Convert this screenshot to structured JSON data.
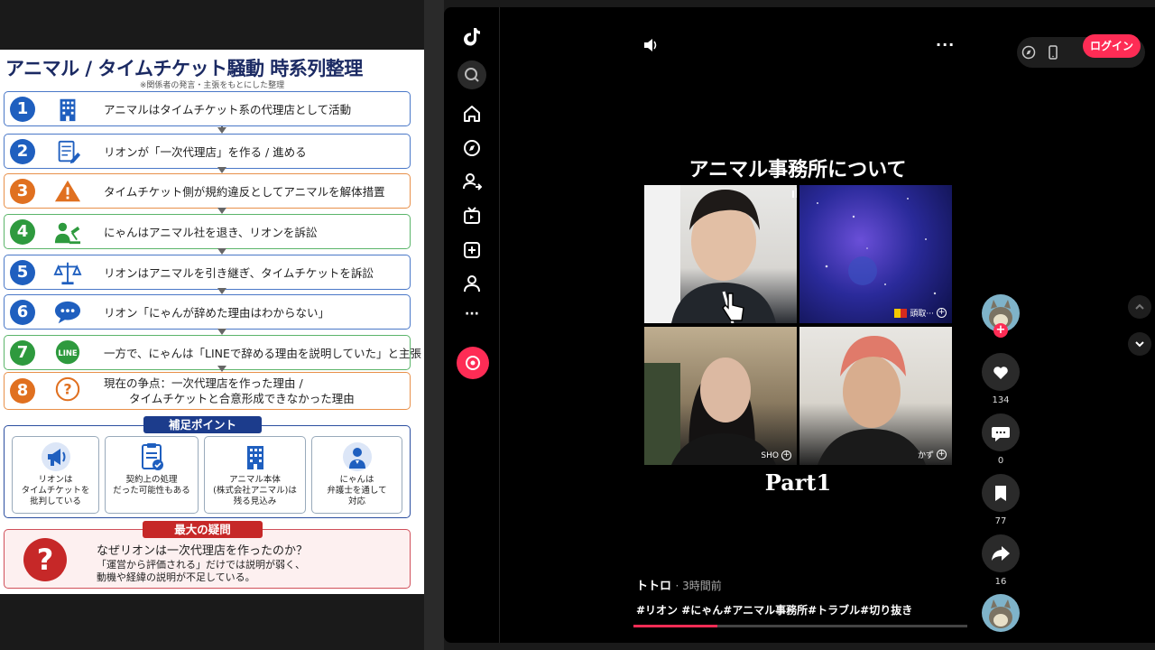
{
  "infographic": {
    "title": "アニマル / タイムチケット騒動  時系列整理",
    "subtitle": "※関係者の発言・主張をもとにした整理",
    "steps": [
      {
        "num": "1",
        "color": "#1f5fbf",
        "icon": "building-icon",
        "text": "アニマルはタイムチケット系の代理店として活動"
      },
      {
        "num": "2",
        "color": "#1f5fbf",
        "icon": "document-pen-icon",
        "text": "リオンが「一次代理店」を作る / 進める"
      },
      {
        "num": "3",
        "color": "#e07020",
        "icon": "warning-icon",
        "text": "タイムチケット側が規約違反としてアニマルを解体措置"
      },
      {
        "num": "4",
        "color": "#2e9a3e",
        "icon": "person-gavel-icon",
        "text": "にゃんはアニマル社を退き、リオンを訴訟"
      },
      {
        "num": "5",
        "color": "#1f5fbf",
        "icon": "scales-icon",
        "text": "リオンはアニマルを引き継ぎ、タイムチケットを訴訟"
      },
      {
        "num": "6",
        "color": "#1f5fbf",
        "icon": "speech-bubble-icon",
        "text": "リオン「にゃんが辞めた理由はわからない」"
      },
      {
        "num": "7",
        "color": "#2e9a3e",
        "icon": "line-icon",
        "text": "一方で、にゃんは「LINEで辞める理由を説明していた」と主張"
      },
      {
        "num": "8",
        "color": "#e07020",
        "icon": "question-icon",
        "text_line1": "現在の争点：一次代理店を作った理由 /",
        "text_line2": "タイムチケットと合意形成できなかった理由"
      }
    ],
    "hosoku": {
      "label": "補足ポイント",
      "cards": [
        {
          "icon": "megaphone-icon",
          "text": "リオンは\nタイムチケットを\n批判している"
        },
        {
          "icon": "clipboard-check-icon",
          "text": "契約上の処理\nだった可能性もある"
        },
        {
          "icon": "building-icon",
          "text": "アニマル本体\n(株式会社アニマル)は\n残る見込み"
        },
        {
          "icon": "lawyer-icon",
          "text": "にゃんは\n弁護士を通して\n対応"
        }
      ]
    },
    "saidai": {
      "label": "最大の疑問",
      "question": "なぜリオンは一次代理店を作ったのか？",
      "note": "「運営から評価される」だけでは説明が弱く、\n動機や経緯の説明が不足している。"
    },
    "line_badge": "LINE"
  },
  "tiktok": {
    "sidebar_icons": [
      "tiktok-logo-icon",
      "search-icon",
      "home-icon",
      "explore-icon",
      "following-icon",
      "live-icon",
      "upload-icon",
      "profile-icon",
      "more-icon",
      "live-button-icon"
    ],
    "more_dots": "···",
    "login_label": "ログイン",
    "video": {
      "title": "アニマル事務所について",
      "part": "Part1",
      "tile_labels": [
        "",
        "頭取···",
        "SHO",
        "かず"
      ],
      "plus": "+"
    },
    "actions": {
      "likes": "134",
      "comments": "0",
      "saves": "77",
      "shares": "16"
    },
    "author": "トトロ",
    "posted": "· 3時間前",
    "hashtags": "#リオン #にゃん#アニマル事務所#トラブル#切り抜き",
    "progress": 0.25
  }
}
